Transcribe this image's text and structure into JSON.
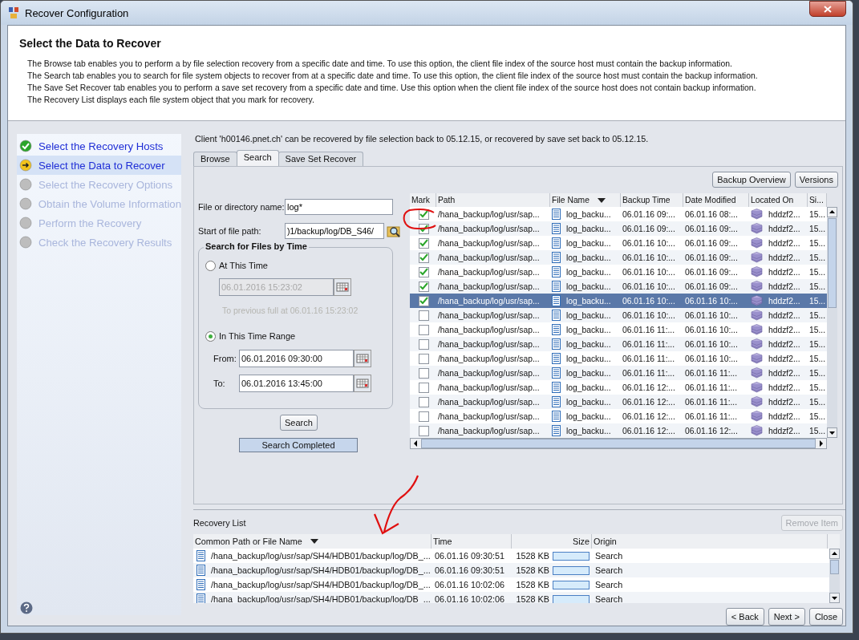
{
  "window": {
    "title": "Recover Configuration"
  },
  "header": {
    "title": "Select the Data to Recover",
    "lines": [
      "The Browse tab enables you to perform a by file selection recovery from a specific date and time. To use this option, the client file index of the source host must contain the backup information.",
      "The Search tab enables you to search for file system objects to recover from at a specific date and time. To use this option, the client file index of the source host must contain the backup information.",
      "The Save Set Recover tab enables you to perform a save set recovery from a specific date and time.  Use this option when the client file index of the source host does not contain backup information.",
      "The Recovery List displays each file system object that you mark for recovery."
    ]
  },
  "steps": [
    {
      "label": "Select the Recovery Hosts",
      "kind": "done",
      "selected": false
    },
    {
      "label": "Select the Data to Recover",
      "kind": "current",
      "selected": true
    },
    {
      "label": "Select the Recovery Options",
      "kind": "pending",
      "selected": false
    },
    {
      "label": "Obtain the Volume Information",
      "kind": "pending",
      "selected": false
    },
    {
      "label": "Perform the Recovery",
      "kind": "pending",
      "selected": false
    },
    {
      "label": "Check the Recovery Results",
      "kind": "pending",
      "selected": false
    }
  ],
  "client_note": "Client 'h00146.pnet.ch' can be recovered by file selection back to 05.12.15, or recovered by save set back to 05.12.15.",
  "tabs": [
    {
      "label": "Browse",
      "selected": false
    },
    {
      "label": "Search",
      "selected": true
    },
    {
      "label": "Save Set Recover",
      "selected": false
    }
  ],
  "search_form": {
    "name_label": "File or directory name:",
    "name_value": "log*",
    "path_label": "Start of file path:",
    "path_value": ")1/backup/log/DB_S46/",
    "group_title": "Search for Files by Time",
    "at_time": {
      "label": "At This Time",
      "selected": false,
      "value": "06.01.2016 15:23:02",
      "disabled": true,
      "note": "To previous full at 06.01.16 15:23:02"
    },
    "range": {
      "label": "In This Time Range",
      "selected": true,
      "from_label": "From:",
      "from_value": "06.01.2016 09:30:00",
      "to_label": "To:",
      "to_value": "06.01.2016 13:45:00"
    },
    "search_button": "Search",
    "status": "Search Completed"
  },
  "toolbar_buttons": [
    "Backup Overview",
    "Versions"
  ],
  "file_table": {
    "columns": [
      "Mark",
      "Path",
      "File Name",
      "Backup Time",
      "Date Modified",
      "Located On",
      "Si..."
    ],
    "rows": [
      {
        "checked": true,
        "selected": false,
        "path": "/hana_backup/log/usr/sap...",
        "file": "log_backu...",
        "backup": "06.01.16 09:...",
        "modified": "06.01.16 08:...",
        "located": "hddzf2...",
        "size": "15..."
      },
      {
        "checked": true,
        "selected": false,
        "path": "/hana_backup/log/usr/sap...",
        "file": "log_backu...",
        "backup": "06.01.16 09:...",
        "modified": "06.01.16 09:...",
        "located": "hddzf2...",
        "size": "15..."
      },
      {
        "checked": true,
        "selected": false,
        "path": "/hana_backup/log/usr/sap...",
        "file": "log_backu...",
        "backup": "06.01.16 10:...",
        "modified": "06.01.16 09:...",
        "located": "hddzf2...",
        "size": "15..."
      },
      {
        "checked": true,
        "selected": false,
        "path": "/hana_backup/log/usr/sap...",
        "file": "log_backu...",
        "backup": "06.01.16 10:...",
        "modified": "06.01.16 09:...",
        "located": "hddzf2...",
        "size": "15..."
      },
      {
        "checked": true,
        "selected": false,
        "path": "/hana_backup/log/usr/sap...",
        "file": "log_backu...",
        "backup": "06.01.16 10:...",
        "modified": "06.01.16 09:...",
        "located": "hddzf2...",
        "size": "15..."
      },
      {
        "checked": true,
        "selected": false,
        "path": "/hana_backup/log/usr/sap...",
        "file": "log_backu...",
        "backup": "06.01.16 10:...",
        "modified": "06.01.16 09:...",
        "located": "hddzf2...",
        "size": "15..."
      },
      {
        "checked": true,
        "selected": true,
        "path": "/hana_backup/log/usr/sap...",
        "file": "log_backu...",
        "backup": "06.01.16 10:...",
        "modified": "06.01.16 10:...",
        "located": "hddzf2...",
        "size": "15..."
      },
      {
        "checked": false,
        "selected": false,
        "path": "/hana_backup/log/usr/sap...",
        "file": "log_backu...",
        "backup": "06.01.16 10:...",
        "modified": "06.01.16 10:...",
        "located": "hddzf2...",
        "size": "15..."
      },
      {
        "checked": false,
        "selected": false,
        "path": "/hana_backup/log/usr/sap...",
        "file": "log_backu...",
        "backup": "06.01.16 11:...",
        "modified": "06.01.16 10:...",
        "located": "hddzf2...",
        "size": "15..."
      },
      {
        "checked": false,
        "selected": false,
        "path": "/hana_backup/log/usr/sap...",
        "file": "log_backu...",
        "backup": "06.01.16 11:...",
        "modified": "06.01.16 10:...",
        "located": "hddzf2...",
        "size": "15..."
      },
      {
        "checked": false,
        "selected": false,
        "path": "/hana_backup/log/usr/sap...",
        "file": "log_backu...",
        "backup": "06.01.16 11:...",
        "modified": "06.01.16 10:...",
        "located": "hddzf2...",
        "size": "15..."
      },
      {
        "checked": false,
        "selected": false,
        "path": "/hana_backup/log/usr/sap...",
        "file": "log_backu...",
        "backup": "06.01.16 11:...",
        "modified": "06.01.16 11:...",
        "located": "hddzf2...",
        "size": "15..."
      },
      {
        "checked": false,
        "selected": false,
        "path": "/hana_backup/log/usr/sap...",
        "file": "log_backu...",
        "backup": "06.01.16 12:...",
        "modified": "06.01.16 11:...",
        "located": "hddzf2...",
        "size": "15..."
      },
      {
        "checked": false,
        "selected": false,
        "path": "/hana_backup/log/usr/sap...",
        "file": "log_backu...",
        "backup": "06.01.16 12:...",
        "modified": "06.01.16 11:...",
        "located": "hddzf2...",
        "size": "15..."
      },
      {
        "checked": false,
        "selected": false,
        "path": "/hana_backup/log/usr/sap...",
        "file": "log_backu...",
        "backup": "06.01.16 12:...",
        "modified": "06.01.16 11:...",
        "located": "hddzf2...",
        "size": "15..."
      },
      {
        "checked": false,
        "selected": false,
        "path": "/hana_backup/log/usr/sap...",
        "file": "log_backu...",
        "backup": "06.01.16 12:...",
        "modified": "06.01.16 12:...",
        "located": "hddzf2...",
        "size": "15..."
      }
    ]
  },
  "recovery_list": {
    "title": "Recovery List",
    "remove_button": {
      "label": "Remove Item",
      "disabled": true
    },
    "columns": [
      "Common Path or File Name",
      "Time",
      "Size",
      "Origin"
    ],
    "rows": [
      {
        "path": "/hana_backup/log/usr/sap/SH4/HDB01/backup/log/DB_...",
        "time": "06.01.16 09:30:51",
        "size": "1528 KB",
        "origin": "Search"
      },
      {
        "path": "/hana_backup/log/usr/sap/SH4/HDB01/backup/log/DB_...",
        "time": "06.01.16 09:30:51",
        "size": "1528 KB",
        "origin": "Search"
      },
      {
        "path": "/hana_backup/log/usr/sap/SH4/HDB01/backup/log/DB_...",
        "time": "06.01.16 10:02:06",
        "size": "1528 KB",
        "origin": "Search"
      },
      {
        "path": "/hana_backup/log/usr/sap/SH4/HDB01/backup/log/DB_...",
        "time": "06.01.16 10:02:06",
        "size": "1528 KB",
        "origin": "Search"
      }
    ]
  },
  "footer_buttons": [
    "< Back",
    "Next >",
    "Close"
  ]
}
